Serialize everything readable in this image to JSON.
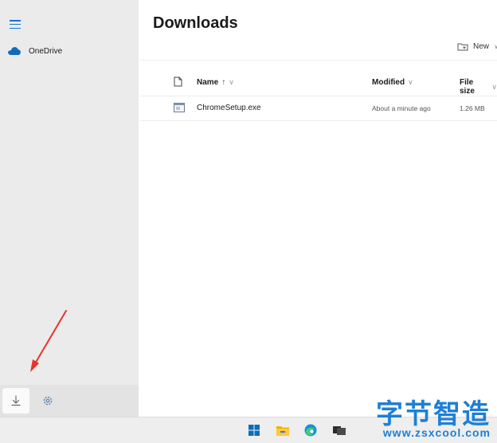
{
  "sidebar": {
    "nav_items": [
      {
        "label": "OneDrive",
        "icon": "onedrive-cloud-icon"
      }
    ],
    "bottom_buttons": [
      {
        "icon": "download-icon"
      },
      {
        "icon": "settings-gear-icon"
      }
    ]
  },
  "main": {
    "title": "Downloads",
    "toolbar": {
      "new_label": "New"
    },
    "columns": [
      {
        "label": "Name",
        "sort": "ascending"
      },
      {
        "label": "Modified"
      },
      {
        "label": "File size"
      }
    ],
    "files": [
      {
        "name": "ChromeSetup.exe",
        "modified": "About a minute ago",
        "size": "1.26 MB"
      }
    ]
  },
  "taskbar": {
    "icons": [
      "windows-start-icon",
      "file-explorer-icon",
      "edge-browser-icon",
      "task-view-icon"
    ]
  },
  "watermark": {
    "text_cn": "字节智造",
    "url": "www.zsxcool.com"
  },
  "colors": {
    "accent": "#0f6cbd",
    "annotation_arrow": "#e8322b",
    "watermark": "#1e7fd6"
  }
}
